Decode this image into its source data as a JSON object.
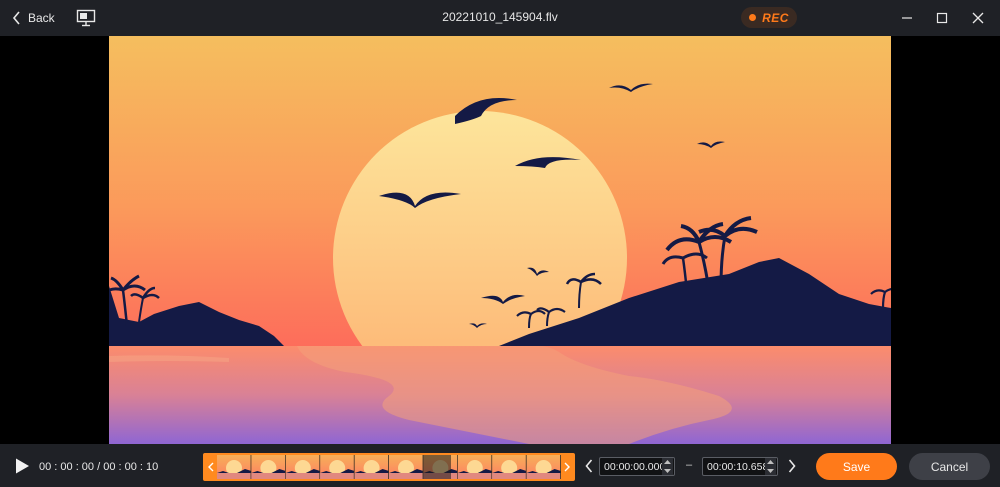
{
  "titlebar": {
    "back_label": "Back",
    "back_icon": "chevron-left-icon",
    "screen_icon": "monitor-icon",
    "file_name": "20221010_145904.flv",
    "rec_label": "REC",
    "rec_color": "#ff7a1a"
  },
  "video": {
    "scene": "sunset-island-illustration"
  },
  "controls": {
    "play_icon": "play-icon",
    "current_time": "00 : 00 : 00 / 00 : 00 : 10",
    "timeline_thumbnails": 10,
    "start_time": "00:00:00.000",
    "end_time": "00:00:10.658",
    "dash": "–",
    "save_label": "Save",
    "cancel_label": "Cancel",
    "accent_color": "#ff7a1a"
  }
}
